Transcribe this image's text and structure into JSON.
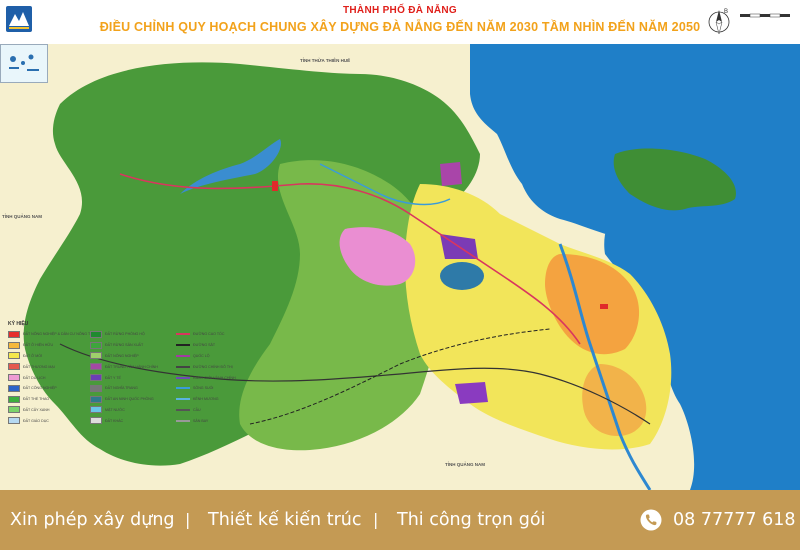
{
  "header": {
    "subtitle": "THÀNH PHỐ ĐÀ NẴNG",
    "title": "ĐIỀU CHỈNH QUY HOẠCH CHUNG XÂY DỰNG ĐÀ NẴNG ĐẾN NĂM 2030 TẦM NHÌN ĐẾN NĂM 2050",
    "compass_letter": "B"
  },
  "map": {
    "labels": {
      "north": "TỈNH THỪA THIÊN HUẾ",
      "west": "TỈNH QUẢNG NAM",
      "south": "TỈNH QUẢNG NAM"
    },
    "legend": {
      "title": "KÝ HIỆU",
      "col1": [
        {
          "text": "ĐẤT NÔNG NGHIỆP & DÂN CƯ NÔNG THÔN",
          "color": "#e62e2e"
        },
        {
          "text": "ĐẤT Ở HIỆN HỮU",
          "color": "#f6b93b"
        },
        {
          "text": "ĐẤT Ở MỚI",
          "color": "#f4e84d"
        },
        {
          "text": "ĐẤT THƯƠNG MẠI",
          "color": "#e55a4e"
        },
        {
          "text": "ĐẤT DU LỊCH",
          "color": "#ee9bd3"
        },
        {
          "text": "ĐẤT CÔNG NGHIỆP",
          "color": "#2c63c9"
        },
        {
          "text": "ĐẤT THỂ THAO",
          "color": "#3eaf3e"
        },
        {
          "text": "ĐẤT CÂY XANH",
          "color": "#7bd36b"
        },
        {
          "text": "ĐẤT GIÁO DỤC",
          "color": "#b5d9f2"
        }
      ],
      "col2": [
        {
          "text": "ĐẤT RỪNG PHÒNG HỘ",
          "color": "#1f8a2f"
        },
        {
          "text": "ĐẤT RỪNG SẢN XUẤT",
          "color": "#3ea53c"
        },
        {
          "text": "ĐẤT NÔNG NGHIỆP",
          "color": "#9fd06b"
        },
        {
          "text": "ĐẤT TRUNG TÂM HÀNH CHÍNH",
          "color": "#a34aa3"
        },
        {
          "text": "ĐẤT Y TẾ",
          "color": "#6b3fb5"
        },
        {
          "text": "ĐẤT NGHĨA TRANG",
          "color": "#777777"
        },
        {
          "text": "ĐẤT AN NINH QUỐC PHÒNG",
          "color": "#2f7a8c"
        },
        {
          "text": "MẶT NƯỚC",
          "color": "#69c6e9"
        },
        {
          "text": "ĐẤT KHÁC",
          "color": "#dddddd"
        }
      ],
      "col3": [
        {
          "text": "ĐƯỜNG CAO TỐC",
          "color": "#d9365e"
        },
        {
          "text": "ĐƯỜNG SẮT",
          "color": "#222222"
        },
        {
          "text": "QUỐC LỘ",
          "color": "#a23ba2"
        },
        {
          "text": "ĐƯỜNG CHÍNH ĐÔ THỊ",
          "color": "#444444"
        },
        {
          "text": "RANH GIỚI HÀNH CHÍNH",
          "color": "#6d4bb5"
        },
        {
          "text": "SÔNG SUỐI",
          "color": "#3a9bd9"
        },
        {
          "text": "KÊNH MƯƠNG",
          "color": "#5ab3e0"
        },
        {
          "text": "CẦU",
          "color": "#555555"
        },
        {
          "text": "SÂN BAY",
          "color": "#999999"
        }
      ]
    }
  },
  "footer": {
    "item1": "Xin phép xây dựng",
    "item2": "Thiết kế kiến trúc",
    "item3": "Thi công trọn gói",
    "separator": "|",
    "phone": "08 77777 618",
    "background": "#c49a54"
  }
}
